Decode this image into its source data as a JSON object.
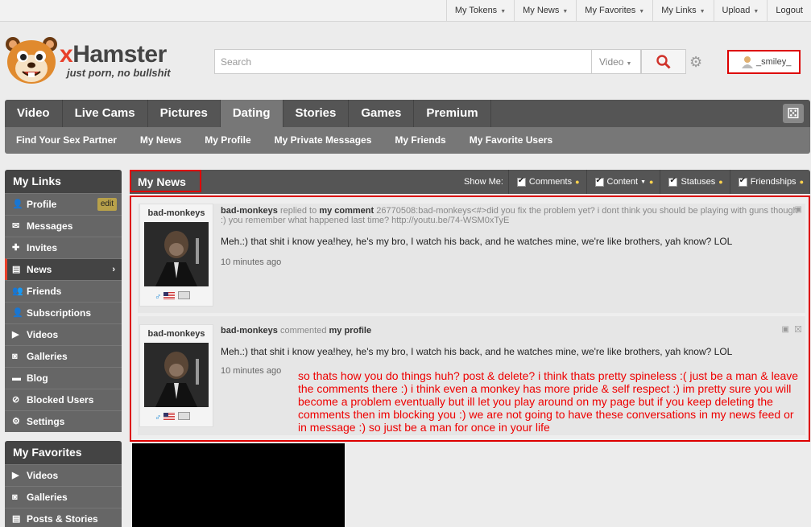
{
  "top_links": [
    {
      "label": "My Tokens",
      "dropdown": true
    },
    {
      "label": "My News",
      "dropdown": true
    },
    {
      "label": "My Favorites",
      "dropdown": true
    },
    {
      "label": "My Links",
      "dropdown": true
    },
    {
      "label": "Upload",
      "dropdown": true
    },
    {
      "label": "Logout",
      "dropdown": false
    }
  ],
  "logo": {
    "brand_x": "x",
    "brand_rest": "Hamster",
    "tagline": "just porn, no bullshit"
  },
  "search": {
    "placeholder": "Search",
    "type_value": "Video"
  },
  "user": {
    "name": "_smiley_"
  },
  "main_nav": [
    "Video",
    "Live Cams",
    "Pictures",
    "Dating",
    "Stories",
    "Games",
    "Premium"
  ],
  "main_nav_active": "Dating",
  "sub_nav": [
    "Find Your Sex Partner",
    "My News",
    "My Profile",
    "My Private Messages",
    "My Friends",
    "My Favorite Users"
  ],
  "sidebar": {
    "links_title": "My Links",
    "links": [
      {
        "label": "Profile",
        "icon": "user-icon",
        "extra": "edit"
      },
      {
        "label": "Messages",
        "icon": "envelope-icon"
      },
      {
        "label": "Invites",
        "icon": "invite-icon"
      },
      {
        "label": "News",
        "icon": "news-icon",
        "active": true
      },
      {
        "label": "Friends",
        "icon": "friends-icon"
      },
      {
        "label": "Subscriptions",
        "icon": "subscriptions-icon"
      },
      {
        "label": "Videos",
        "icon": "video-icon"
      },
      {
        "label": "Galleries",
        "icon": "camera-icon"
      },
      {
        "label": "Blog",
        "icon": "blog-icon"
      },
      {
        "label": "Blocked Users",
        "icon": "blocked-icon"
      },
      {
        "label": "Settings",
        "icon": "gear-icon"
      }
    ],
    "favorites_title": "My Favorites",
    "favorites": [
      {
        "label": "Videos",
        "icon": "video-icon"
      },
      {
        "label": "Galleries",
        "icon": "camera-icon"
      },
      {
        "label": "Posts & Stories",
        "icon": "stories-icon"
      }
    ]
  },
  "news": {
    "title": "My News",
    "show_me_label": "Show Me:",
    "filters": [
      {
        "label": "Comments",
        "checked": true,
        "dropdown": false
      },
      {
        "label": "Content",
        "checked": true,
        "dropdown": true
      },
      {
        "label": "Statuses",
        "checked": true,
        "dropdown": false
      },
      {
        "label": "Friendships",
        "checked": true,
        "dropdown": false
      }
    ],
    "entries": [
      {
        "user": "bad-monkeys",
        "action": "replied to",
        "target": "my comment",
        "quote": "26770508:bad-monkeys<#>did you fix the problem yet? i dont think you should be playing with guns though :) you remember what happened last time? http://youtu.be/74-WSM0xTyE",
        "text": "Meh.:) that shit i know yea!hey, he's my bro, I watch his back, and he watches mine, we're like brothers, yah know? LOL",
        "time": "10 minutes ago"
      },
      {
        "user": "bad-monkeys",
        "action": "commented",
        "target": "my profile",
        "quote": "",
        "text": "Meh.:) that shit i know yea!hey, he's my bro, I watch his back, and he watches mine, we're like brothers, yah know? LOL",
        "time": "10 minutes ago"
      }
    ]
  },
  "annotation": "so thats how you do things huh? post & delete? i think thats pretty spineless :( just be a man & leave the comments there :) i think even a monkey has more pride & self respect :) im pretty sure you will become a problem eventually but ill let you play around on my page but if you keep deleting the comments then im blocking you :) we are not going to have these conversations in my news feed or in message :) so just be a man for once in your life",
  "colors": {
    "accent": "#e8402b",
    "highlight": "#dd0000",
    "nav": "#555555",
    "subnav": "#777777"
  }
}
